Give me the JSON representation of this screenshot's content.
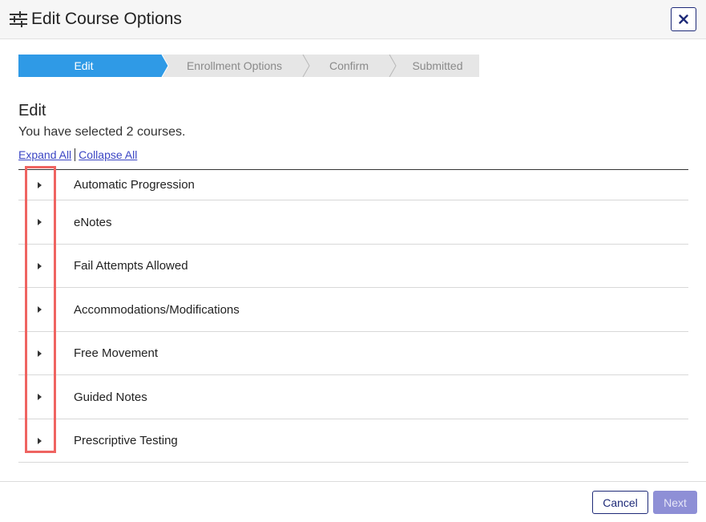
{
  "dialog": {
    "title": "Edit Course Options",
    "menu_icon": "sliders-icon",
    "close_icon": "close-icon"
  },
  "stepper": {
    "steps": [
      {
        "label": "Edit",
        "active": true
      },
      {
        "label": "Enrollment Options",
        "active": false
      },
      {
        "label": "Confirm",
        "active": false
      },
      {
        "label": "Submitted",
        "active": false
      }
    ],
    "active_color": "#2f9ae6",
    "inactive_color": "#e6e6e6"
  },
  "section": {
    "title": "Edit",
    "subtitle": "You have selected 2 courses."
  },
  "links": {
    "expand_all": "Expand All",
    "collapse_all": "Collapse All"
  },
  "options": [
    {
      "label": "Automatic Progression"
    },
    {
      "label": "eNotes"
    },
    {
      "label": "Fail Attempts Allowed"
    },
    {
      "label": "Accommodations/Modifications"
    },
    {
      "label": "Free Movement"
    },
    {
      "label": "Guided Notes"
    },
    {
      "label": "Prescriptive Testing"
    }
  ],
  "footer": {
    "cancel_label": "Cancel",
    "next_label": "Next"
  },
  "colors": {
    "highlight": "#ef6461",
    "primary": "#1e2a78",
    "next_disabled": "#8e8fd6"
  }
}
